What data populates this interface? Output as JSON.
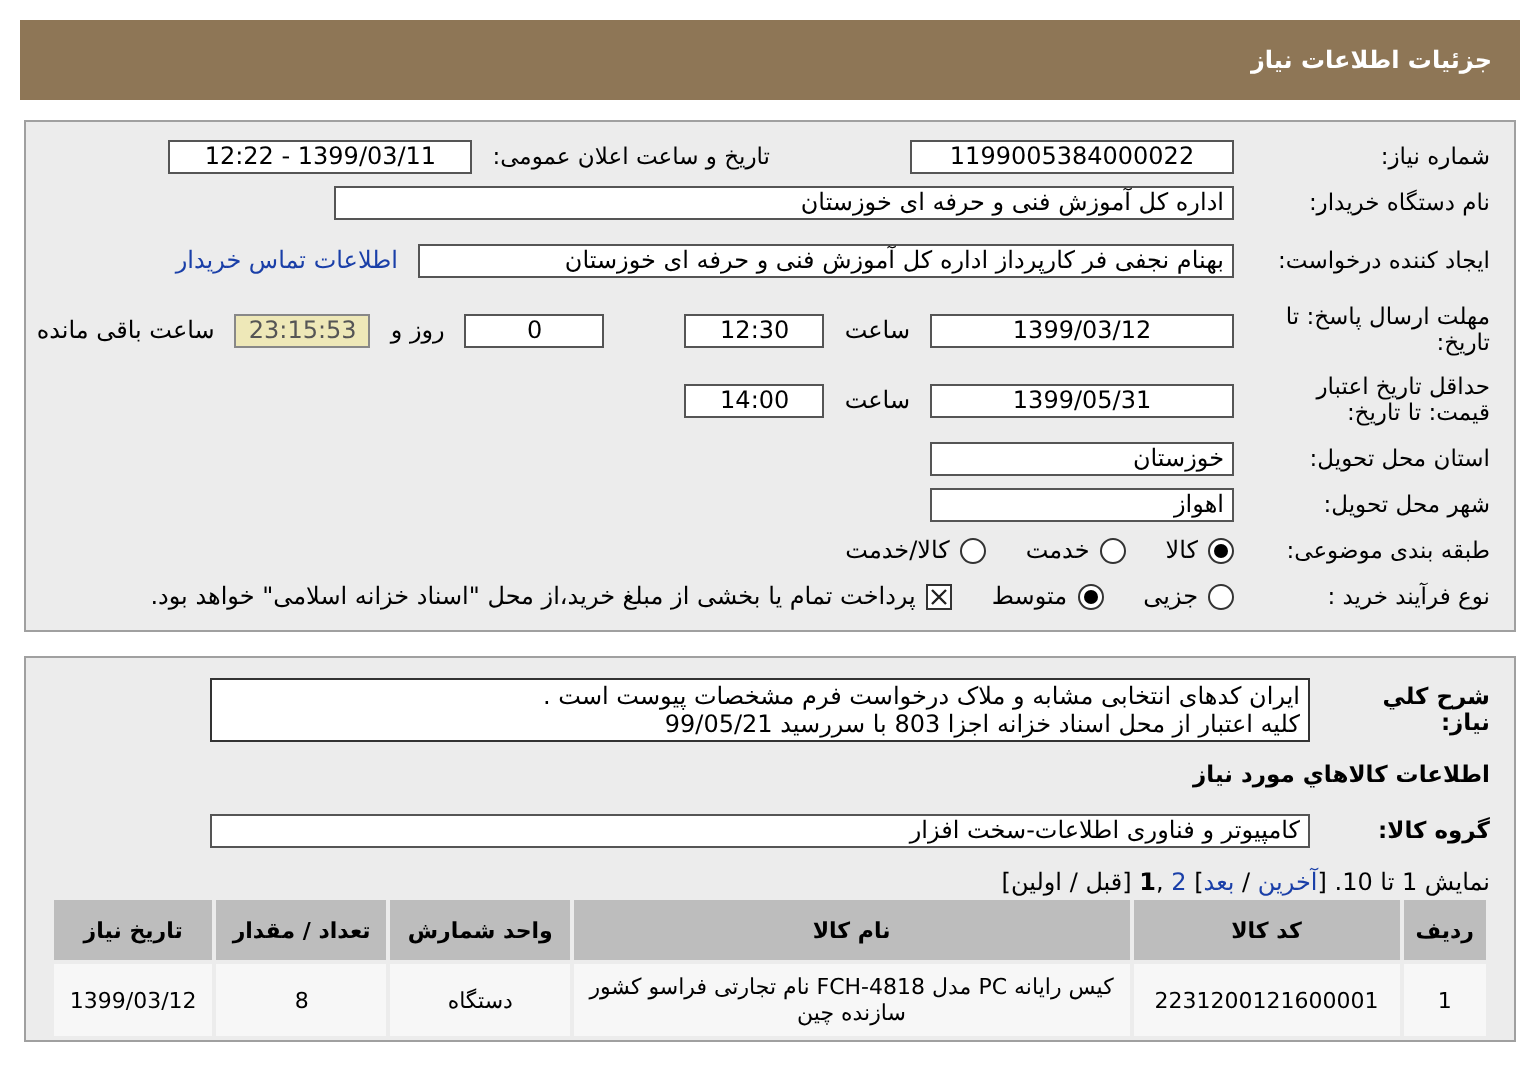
{
  "header": {
    "title": "جزئیات اطلاعات نیاز"
  },
  "need_number": {
    "label": "شماره نیاز:",
    "value": "1199005384000022"
  },
  "announce": {
    "label": "تاریخ و ساعت اعلان عمومی:",
    "value": "1399/03/11 - 12:22"
  },
  "buyer": {
    "label": "نام دستگاه خریدار:",
    "value": "اداره کل آموزش فنی و حرفه ای خوزستان"
  },
  "creator": {
    "label": "ایجاد کننده درخواست:",
    "value": "بهنام  نجفی فر  کارپرداز اداره کل آموزش فنی و حرفه ای خوزستان",
    "link": "اطلاعات تماس خریدار"
  },
  "deadline": {
    "label": "مهلت ارسال پاسخ: تا تاریخ:",
    "date": "1399/03/12",
    "time_label": "ساعت",
    "time": "12:30",
    "days": "0",
    "days_label": "روز و",
    "remaining": "23:15:53",
    "remaining_label": "ساعت باقی مانده"
  },
  "validity": {
    "label": "حداقل تاریخ اعتبار قیمت: تا تاریخ:",
    "date": "1399/05/31",
    "time_label": "ساعت",
    "time": "14:00"
  },
  "province": {
    "label": "استان محل تحویل:",
    "value": "خوزستان"
  },
  "city": {
    "label": "شهر محل تحویل:",
    "value": "اهواز"
  },
  "category": {
    "label": "طبقه بندی موضوعی:",
    "options": [
      {
        "label": "کالا",
        "selected": true
      },
      {
        "label": "خدمت",
        "selected": false
      },
      {
        "label": "کالا/خدمت",
        "selected": false
      }
    ]
  },
  "process": {
    "label": "نوع فرآیند خرید :",
    "options": [
      {
        "label": "جزیی",
        "selected": false
      },
      {
        "label": "متوسط",
        "selected": true
      }
    ],
    "treasury": {
      "checked": true,
      "label": "پرداخت تمام یا بخشی از مبلغ خرید،از محل \"اسناد خزانه اسلامی\" خواهد بود."
    }
  },
  "description": {
    "label": "شرح کلي نياز:",
    "lines": [
      "ایران کدهای انتخابی مشابه و ملاک درخواست فرم مشخصات پیوست است .",
      "کلیه اعتبار از محل اسناد خزانه اجزا 803 با سررسید 99/05/21"
    ]
  },
  "items_heading": "اطلاعات کالاهاي مورد نياز",
  "goods_group": {
    "label": "گروه کالا:",
    "value": "کامپیوتر و فناوری اطلاعات-سخت افزار"
  },
  "pager": {
    "parts": [
      {
        "kind": "plain",
        "text": "نمایش 1 تا 10. ["
      },
      {
        "kind": "link",
        "text": "آخرین"
      },
      {
        "kind": "plain",
        "text": " / "
      },
      {
        "kind": "link",
        "text": "بعد"
      },
      {
        "kind": "plain",
        "text": "] "
      },
      {
        "kind": "link",
        "text": "2"
      },
      {
        "kind": "plain",
        "text": " ,"
      },
      {
        "kind": "current",
        "text": "1"
      },
      {
        "kind": "plain",
        "text": " [قبل / اولین]"
      }
    ]
  },
  "table": {
    "columns": [
      "ردیف",
      "کد کالا",
      "نام کالا",
      "واحد شمارش",
      "تعداد / مقدار",
      "تاریخ نیاز"
    ],
    "rows": [
      [
        "1",
        "2231200121600001",
        "کیس رایانه PC مدل FCH-4818 نام تجارتی فراسو کشور سازنده چین",
        "دستگاه",
        "8",
        "1399/03/12"
      ]
    ]
  }
}
